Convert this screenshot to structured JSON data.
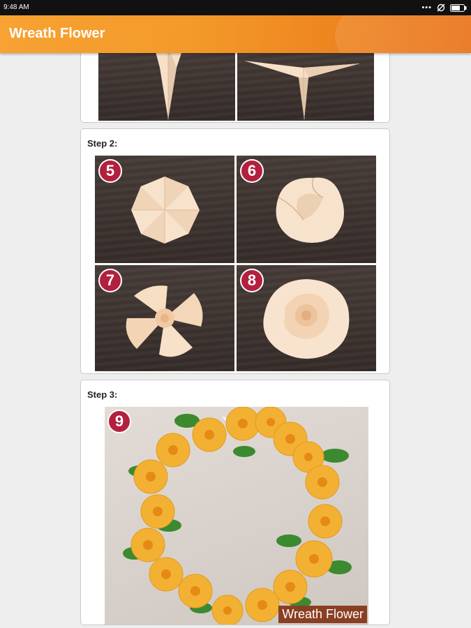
{
  "status_bar": {
    "time": "9:48 AM"
  },
  "app_bar": {
    "title": "Wreath Flower"
  },
  "steps": [
    {
      "label": "Step 2:",
      "badges": [
        "5",
        "6",
        "7",
        "8"
      ]
    },
    {
      "label": "Step 3:",
      "badges": [
        "9"
      ],
      "caption": "Wreath Flower"
    }
  ],
  "colors": {
    "app_bar": "#f39a2a",
    "badge": "#b3203d",
    "paper": "#f6dcc3",
    "rose": "#f3b134",
    "leaf": "#3c8a2f"
  }
}
